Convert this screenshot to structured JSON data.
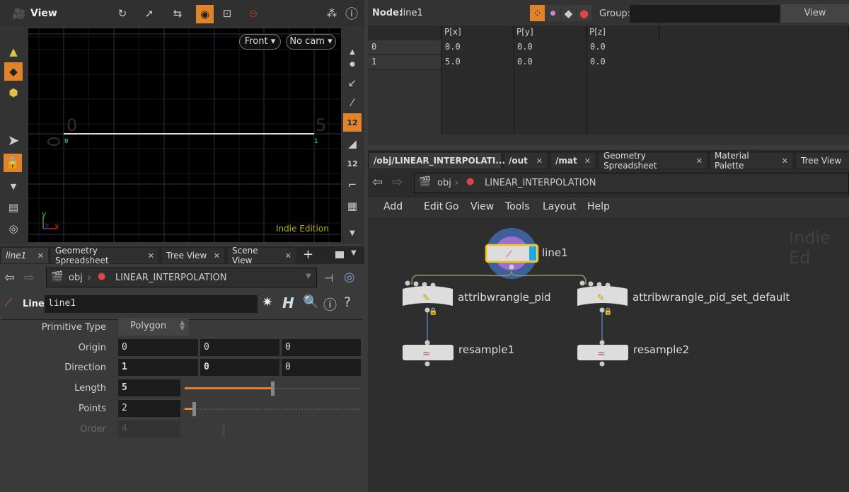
{
  "viewport": {
    "title": "View",
    "view_menu": "Front",
    "camera_menu": "No cam",
    "watermark": "Indie Edition",
    "axis_labels": {
      "origin": "0",
      "end": "5",
      "y_zero": "0"
    },
    "point_numbers": [
      "0",
      "1"
    ],
    "gnomon": {
      "y": "y",
      "z": "z",
      "x": "x"
    },
    "icons": [
      "select-mode-icon",
      "select-icon",
      "handle-icon",
      "view-icon",
      "camera-icon",
      "display-options-icon",
      "help-icon"
    ],
    "right_tools": {
      "point_numbers_badge": "12",
      "prim_numbers_badge": "12"
    }
  },
  "param_panel": {
    "tabs": [
      {
        "label": "line1",
        "active": true
      },
      {
        "label": "Geometry Spreadsheet"
      },
      {
        "label": "Tree View"
      },
      {
        "label": "Scene View"
      }
    ],
    "add_tab": "+",
    "path": {
      "root": "obj",
      "node": "LINEAR_INTERPOLATION"
    },
    "node_type": "Line",
    "node_name": "line1",
    "params": {
      "primitive_type": {
        "label": "Primitive Type",
        "value": "Polygon"
      },
      "origin": {
        "label": "Origin",
        "values": [
          "0",
          "0",
          "0"
        ]
      },
      "direction": {
        "label": "Direction",
        "values": [
          "1",
          "0",
          "0"
        ]
      },
      "length": {
        "label": "Length",
        "value": "5",
        "slider_fraction": 0.5
      },
      "points": {
        "label": "Points",
        "value": "2",
        "slider_fraction": 0.02
      },
      "order": {
        "label": "Order",
        "value": "4",
        "disabled": true
      }
    }
  },
  "spreadsheet": {
    "node_label": "Node:",
    "node_value": "line1",
    "group_label": "Group:",
    "group_value": "",
    "view_button": "View",
    "columns": [
      "",
      "P[x]",
      "P[y]",
      "P[z]"
    ],
    "rows": [
      [
        "0",
        "0.0",
        "0.0",
        "0.0"
      ],
      [
        "1",
        "5.0",
        "0.0",
        "0.0"
      ]
    ]
  },
  "network": {
    "tabs": [
      {
        "label": "/obj/LINEAR_INTERPOLATI...",
        "active": true
      },
      {
        "label": "/out"
      },
      {
        "label": "/mat"
      },
      {
        "label": "Geometry Spreadsheet"
      },
      {
        "label": "Material Palette"
      },
      {
        "label": "Tree View"
      }
    ],
    "path": {
      "root": "obj",
      "node": "LINEAR_INTERPOLATION"
    },
    "menu": [
      "Add",
      "Edit",
      "Go",
      "View",
      "Tools",
      "Layout",
      "Help"
    ],
    "watermark": "Indie Ed",
    "nodes": [
      {
        "name": "line1",
        "type": "line",
        "display": true
      },
      {
        "name": "attribwrangle_pid",
        "type": "attribwrangle",
        "locked": true
      },
      {
        "name": "attribwrangle_pid_set_default",
        "type": "attribwrangle",
        "locked": true
      },
      {
        "name": "resample1",
        "type": "resample"
      },
      {
        "name": "resample2",
        "type": "resample"
      }
    ],
    "colors": {
      "selected": "#f5c400",
      "display_flag": "#1aa8e8",
      "accent": "#e0832a"
    }
  }
}
